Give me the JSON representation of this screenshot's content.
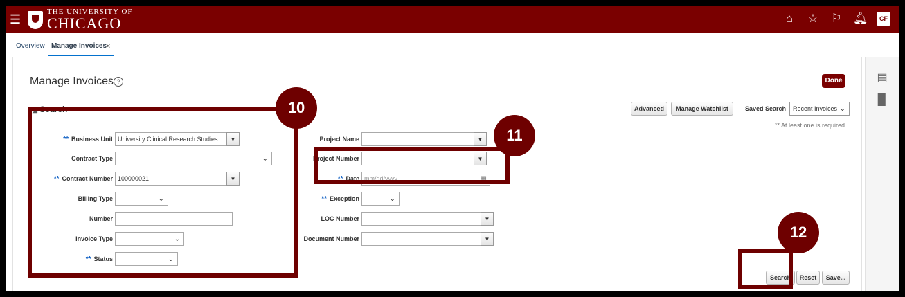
{
  "header": {
    "logo_small": "THE UNIVERSITY OF",
    "logo_big": "CHICAGO",
    "avatar_initials": "CF",
    "brand_color": "#7a0000"
  },
  "tabs": [
    {
      "label": "Overview"
    },
    {
      "label": "Manage Invoices",
      "close": "×"
    }
  ],
  "page": {
    "title": "Manage Invoices",
    "help": "?",
    "done_label": "Done"
  },
  "search": {
    "header": "Search",
    "advanced_label": "Advanced",
    "watchlist_label": "Manage Watchlist",
    "saved_search_label": "Saved Search",
    "saved_search_value": "Recent Invoices",
    "hint": "** At least one is required",
    "search_label": "Search",
    "reset_label": "Reset",
    "save_label": "Save..."
  },
  "fields": {
    "business_unit": {
      "label": "Business Unit",
      "value": "University Clinical Research Studies"
    },
    "contract_type": {
      "label": "Contract Type",
      "value": ""
    },
    "contract_number": {
      "label": "Contract Number",
      "value": "100000021"
    },
    "billing_type": {
      "label": "Billing Type",
      "value": ""
    },
    "number": {
      "label": "Number",
      "value": ""
    },
    "invoice_type": {
      "label": "Invoice Type",
      "value": ""
    },
    "status": {
      "label": "Status",
      "value": ""
    },
    "project_name": {
      "label": "Project Name",
      "value": ""
    },
    "project_number": {
      "label": "Project Number",
      "value": ""
    },
    "date": {
      "label": "Date",
      "placeholder": "mm/dd/yyyy"
    },
    "exception": {
      "label": "Exception",
      "value": ""
    },
    "loc_number": {
      "label": "LOC Number",
      "value": ""
    },
    "document_number": {
      "label": "Document Number",
      "value": ""
    }
  },
  "required_marker": "**",
  "callouts": {
    "c10": "10",
    "c11": "11",
    "c12": "12"
  },
  "callout_color": "#6e0000"
}
